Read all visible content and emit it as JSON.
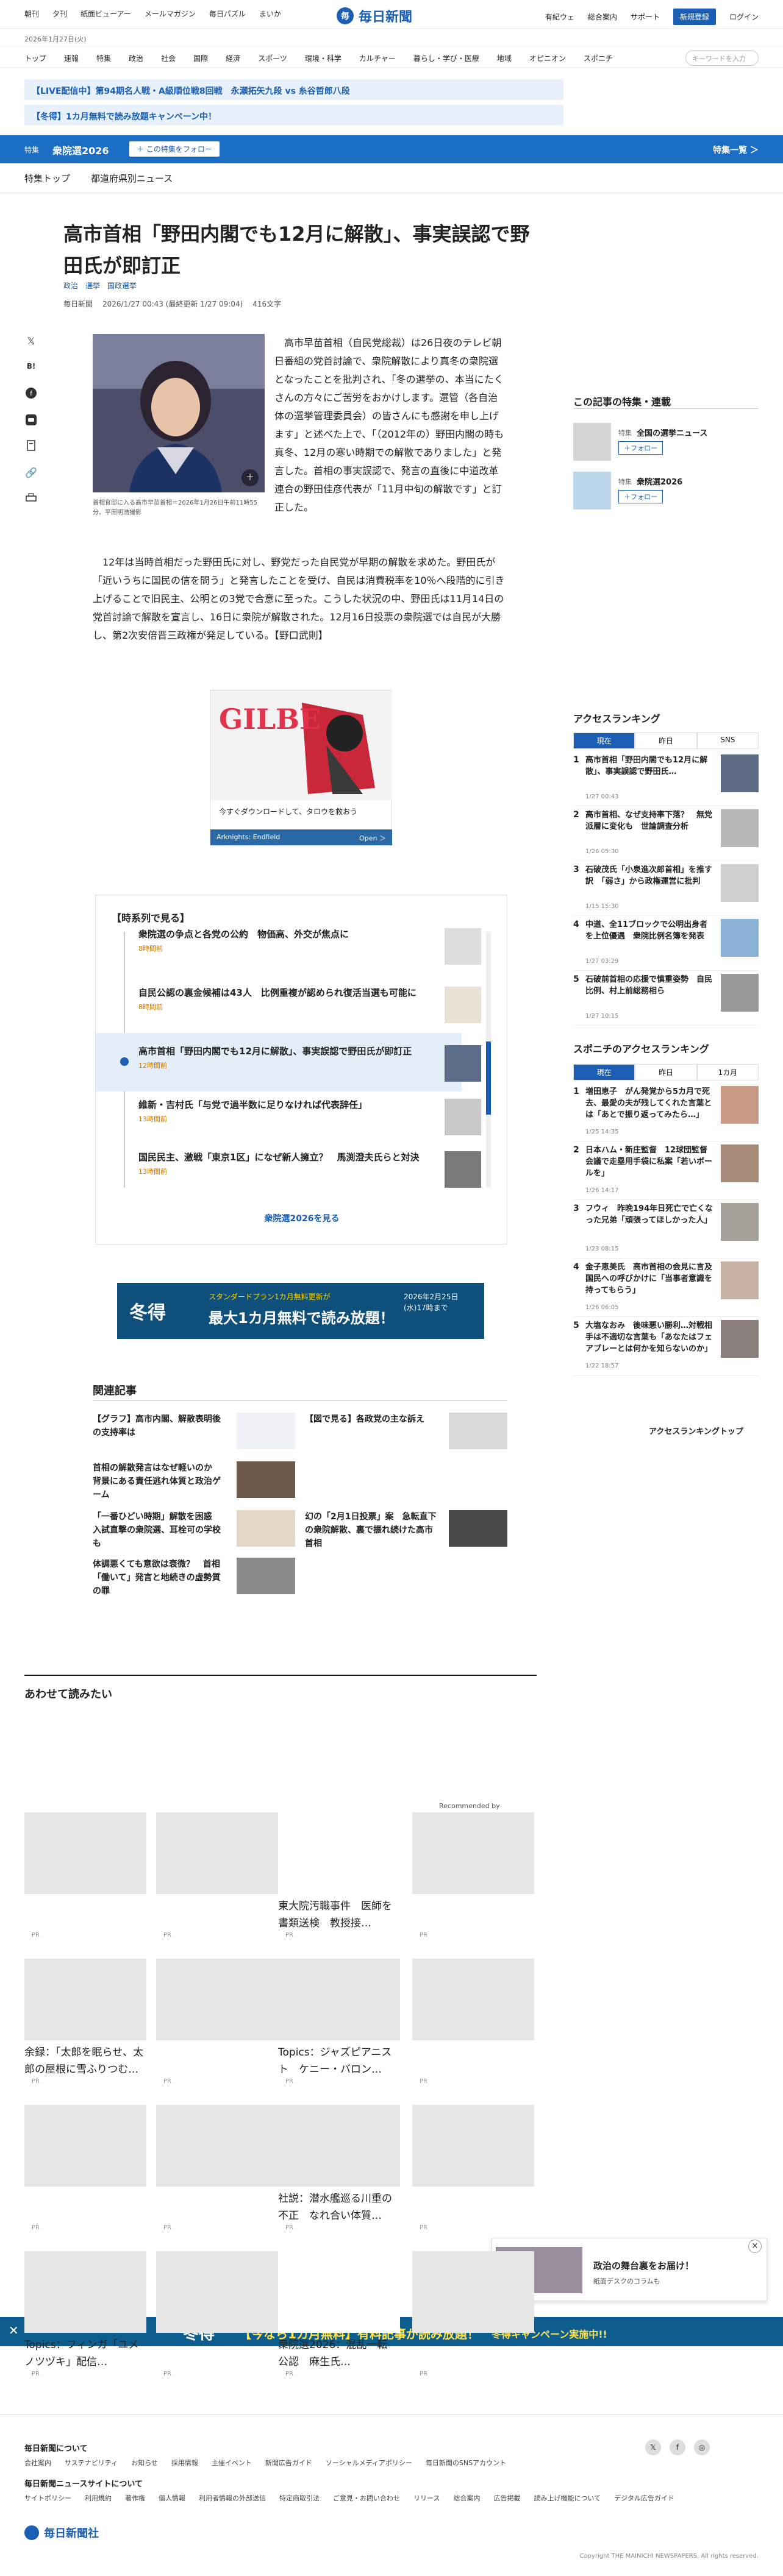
{
  "header": {
    "links": [
      "朝刊",
      "夕刊",
      "紙面ビューアー",
      "メールマガジン",
      "毎日パズル",
      "まいか"
    ],
    "date": "2026年1月27日(火)",
    "logo": "毎日新聞",
    "right_links": [
      "有紀ウェ",
      "総合案内",
      "サポート"
    ],
    "register": "新規登録",
    "login": "ログイン",
    "search_placeholder": "キーワードを入力"
  },
  "nav": [
    "トップ",
    "速報",
    "特集",
    "政治",
    "社会",
    "国際",
    "経済",
    "スポーツ",
    "環境・科学",
    "カルチャー",
    "暮らし・学び・医療",
    "地域",
    "オピニオン",
    "スポニチ"
  ],
  "banners": [
    "【LIVE配信中】第94期名人戦・A級順位戦8回戦　永瀬拓矢九段 vs 糸谷哲郎八段",
    "【冬得】1カ月無料で読み放題キャンペーン中！"
  ],
  "topic": {
    "label": "特集",
    "title": "衆院選2026",
    "follow": "＋ この特集をフォロー",
    "list_link": "特集一覧 ＞"
  },
  "subnav": [
    "特集トップ",
    "都道府県別ニュース"
  ],
  "article": {
    "title": "高市首相「野田内閣でも12月に解散」、事実誤認で野田氏が即訂正",
    "tags": [
      "政治",
      "選挙",
      "国政選挙"
    ],
    "author": "毎日新聞",
    "time": "2026/1/27 00:43 (最終更新 1/27 09:04)",
    "chars": "416文字",
    "caption": "首相官邸に入る高市早苗首相＝2026年1月26日午前11時55分、平田明浩撮影",
    "p1": "　高市早苗首相（自民党総裁）は26日夜のテレビ朝日番組の党首討論で、衆院解散により真冬の衆院選となったことを批判され、「冬の選挙の、本当にたくさんの方々にご苦労をおかけします。選管（各自治体の選挙管理委員会）の皆さんにも感謝を申し上げます」と述べた上で、「（2012年の）野田内閣の時も真冬、12月の寒い時期での解散でありました」と発言した。首相の事実誤認で、発言の直後に中道改革連合の野田佳彦代表が「11月中旬の解散です」と訂正した。",
    "p2": "　12年は当時首相だった野田氏に対し、野党だった自民党が早期の解散を求めた。野田氏が「近いうちに国民の信を問う」と発言したことを受け、自民は消費税率を10％へ段階的に引き上げることで旧民主、公明との3党で合意に至った。こうした状況の中、野田氏は11月14日の党首討論で解散を宣言し、16日に衆院が解散された。12月16日投票の衆院選では自民が大勝し、第2次安倍晋三政権が発足している。【野口武則】"
  },
  "ad1": {
    "brand": "GILBE",
    "line1": "今すぐダウンロードして、タロウを救おう",
    "sponsor": "Arknights: Endfield",
    "open": "Open ＞"
  },
  "series": {
    "title": "【時系列で見る】",
    "items": [
      {
        "text": "衆院選の争点と各党の公約　物価高、外交が焦点に",
        "date": "8時間前"
      },
      {
        "text": "自民公認の裏金候補は43人　比例重複が認められ復活当選も可能に",
        "date": "8時間前"
      },
      {
        "text": "高市首相「野田内閣でも12月に解散」、事実誤認で野田氏が即訂正",
        "date": "12時間前"
      },
      {
        "text": "維新・吉村氏「与党で過半数に足りなければ代表辞任」",
        "date": "13時間前"
      },
      {
        "text": "国民民主、激戦「東京1区」になぜ新人擁立？　馬渕澄夫氏らと対決",
        "date": "13時間前"
      }
    ],
    "more": "衆院選2026を見る"
  },
  "ad2": {
    "badge": "冬得",
    "line1": "スタンダードプラン1カ月無料更新が",
    "line2": "最大1カ月無料で読み放題！",
    "deadline": "2026年2月25日(水)17時まで"
  },
  "related": {
    "title": "関連記事",
    "items": [
      "【グラフ】高市内閣、解散表明後の支持率は",
      "【図で見る】各政党の主な訴え",
      "首相の解散発言はなぜ軽いのか　背景にある責任逃れ体質と政治ゲーム",
      "幻の「2月1日投票」案　急転直下の衆院解散、裏で振れ続けた高市首相",
      "「一番ひどい時期」解散を困惑　入試直撃の衆院選、耳栓可の学校も",
      "体調悪くても意欲は衰微？　首相「働いて」発言と地続きの虚勢質の罪"
    ]
  },
  "recommend": {
    "title": "あわせて読みたい",
    "label": "Recommended by",
    "texts": [
      "東大院汚職事件　医師を書類送検　教授接…",
      "余録：「太郎を眠らせ、太郎の屋根に雪ふりつむ…",
      "Topics：ジャズピアニスト　ケニー・バロン…",
      "社説：潜水艦巡る川重の不正　なれ合い体質…",
      "Topics：フィンガ「ユメノツヅキ」配信…",
      "衆院選2026：混乱一転　公認　麻生氏…"
    ],
    "pr": "PR"
  },
  "sidebar": {
    "follow_title": "この記事の特集・連載",
    "follows": [
      {
        "label": "特集",
        "name": "全国の選挙ニュース",
        "button": "＋フォロー"
      },
      {
        "label": "特集",
        "name": "衆院選2026",
        "button": "＋フォロー"
      }
    ],
    "ranking_title": "アクセスランキング",
    "tabs": [
      "現在",
      "昨日",
      "SNS"
    ],
    "ranking": [
      {
        "text": "高市首相「野田内閣でも12月に解散」、事実誤認で野田氏…",
        "date": "1/27 00:43"
      },
      {
        "text": "高市首相、なぜ支持率下落？　無党派層に変化も　世論調査分析",
        "date": "1/26 05:30"
      },
      {
        "text": "石破茂氏「小泉進次郎首相」を推す訳　「弱さ」から政権運営に批判",
        "date": "1/15 15:30"
      },
      {
        "text": "中道、全11ブロックで公明出身者を上位優遇　衆院比例名簿を発表",
        "date": "1/27 03:29"
      },
      {
        "text": "石破前首相の応援で慎重姿勢　自民比例、村上前総務相ら",
        "date": "1/27 10:15"
      }
    ],
    "sponichi_title": "スポニチのアクセスランキング",
    "sponichi_tabs": [
      "現在",
      "昨日",
      "1カ月"
    ],
    "sponichi": [
      {
        "text": "増田恵子　がん発覚から5カ月で死去、最愛の夫が残してくれた言葉とは「あとで振り返ってみたら…」",
        "date": "1/25 14:35"
      },
      {
        "text": "日本ハム・新庄監督　12球団監督会議で走塁用手袋に私案「若いボールを」",
        "date": "1/26 14:17"
      },
      {
        "text": "フウィ　昨晩194年日死亡で亡くなった兄弟「頑張ってほしかった人」",
        "date": "1/23 08:15"
      },
      {
        "text": "金子恵美氏　高市首相の会見に言及　国民への呼びかけに「当事者意識を持ってもらう」",
        "date": "1/26 06:05"
      },
      {
        "text": "大塩なおみ　後味悪い勝利…対戦相手は不適切な言葉も「あなたはフェアプレーとは何かを知らないのか」",
        "date": "1/22 18:57"
      }
    ],
    "more": "アクセスランキングトップ"
  },
  "float_ad": {
    "title": "政治の舞台裏をお届け！",
    "sub": "紙面デスクのコラムも"
  },
  "bottom_ad": {
    "badge": "冬得",
    "text": "【今なら1カ月無料】有料記事が読み放題！",
    "sub": "冬得キャンペーン実施中!!"
  },
  "footer": {
    "about": "毎日新聞について",
    "row1": [
      "会社案内",
      "サステナビリティ",
      "お知らせ",
      "採用情報",
      "主催イベント",
      "新聞広告ガイド",
      "ソーシャルメディアポリシー",
      "毎日新聞のSNSアカウント"
    ],
    "site": "毎日新聞ニュースサイトについて",
    "row2": [
      "サイトポリシー",
      "利用規約",
      "著作権",
      "個人情報",
      "利用者情報の外部送信",
      "特定商取引法",
      "ご意見・お問い合わせ",
      "リリース",
      "総合案内",
      "広告掲載",
      "読み上げ機能について",
      "デジタル広告ガイド"
    ],
    "company": "毎日新聞社",
    "copyright": "Copyright THE MAINICHI NEWSPAPERS. All rights reserved."
  },
  "colors": {
    "brand": "#1a5fb4",
    "accent": "#1a6fc4",
    "pr": "#c47600"
  }
}
